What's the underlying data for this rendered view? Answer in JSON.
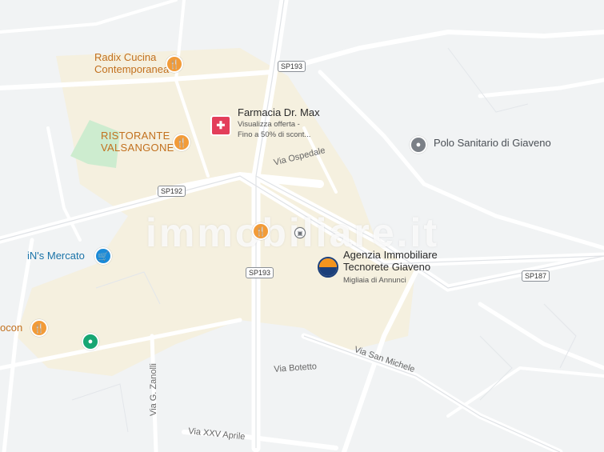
{
  "map": {
    "watermark": "immobiliare.it",
    "labels": {
      "radix": "Radix Cucina",
      "radix_line2": "Contemporanea",
      "farmacia": "Farmacia Dr. Max",
      "farmacia_sub1": "Visualizza offerta -",
      "farmacia_sub2": "Fino a 50% di scont...",
      "ristorante": "RISTORANTE",
      "ristorante_line2": "VALSANGONE",
      "polo": "Polo Sanitario di Giaveno",
      "ins_mercato": "iN's Mercato",
      "agenzia": "Agenzia Immobiliare",
      "agenzia_line2": "Tecnorete Giaveno",
      "agenzia_sub": "Migliaia di Annunci",
      "cocon": "ocon"
    },
    "streets": {
      "via_ospedale": "Via Ospedale",
      "via_san_michele": "Via San Michele",
      "via_botetto": "Via Botetto",
      "via_zanolli": "Via G. Zanolli",
      "via_xxv_aprile": "Via XXV Aprile"
    },
    "roads": {
      "sp193_top": "SP193",
      "sp192": "SP192",
      "sp193_bottom": "SP193",
      "sp187": "SP187"
    },
    "icons": {
      "food": "restaurant-icon",
      "pharmacy": "pharmacy-icon",
      "medical": "medical-icon",
      "shopping": "shopping-cart-icon",
      "bus": "bus-stop-icon",
      "agency": "agency-logo-icon",
      "green": "place-icon"
    }
  }
}
